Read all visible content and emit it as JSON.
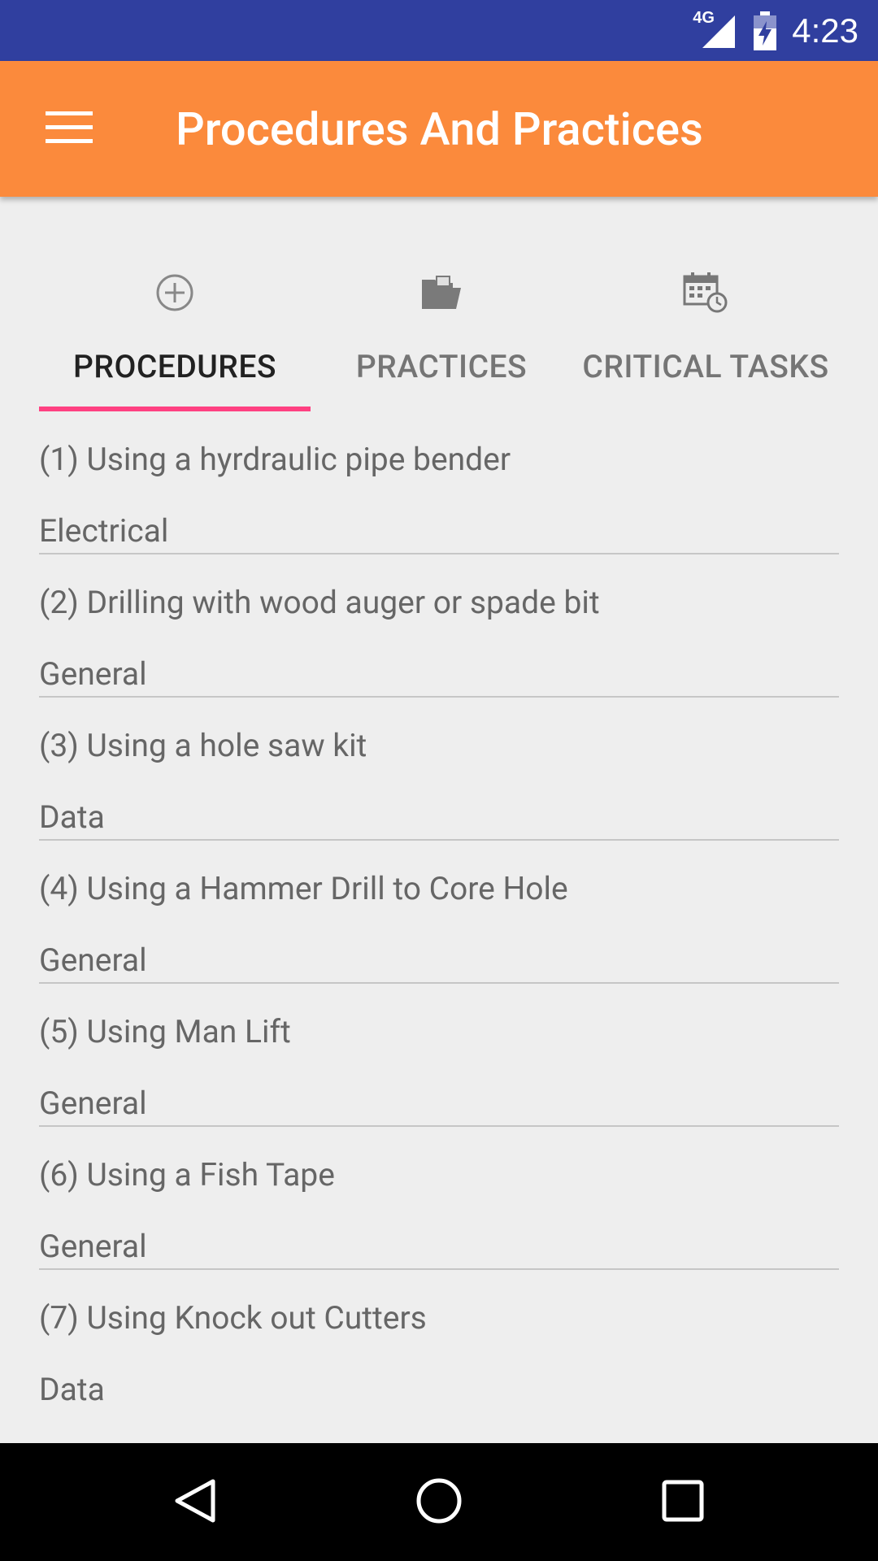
{
  "status_bar": {
    "network": "4G",
    "time": "4:23"
  },
  "app_bar": {
    "title": "Procedures And Practices",
    "menu_icon": "hamburger-menu-icon"
  },
  "tabs": [
    {
      "label": "PROCEDURES",
      "icon": "add-circle-icon",
      "active": true
    },
    {
      "label": "PRACTICES",
      "icon": "open-folder-icon",
      "active": false
    },
    {
      "label": "CRITICAL TASKS",
      "icon": "calendar-refresh-icon",
      "active": false
    }
  ],
  "accent_color": "#ff4081",
  "app_bar_color": "#fb8a3c",
  "status_bar_color": "#303f9f",
  "procedures": [
    {
      "title": "(1) Using a hyrdraulic pipe bender",
      "category": "Electrical"
    },
    {
      "title": "(2) Drilling with wood auger or spade bit",
      "category": "General"
    },
    {
      "title": "(3) Using a hole saw kit",
      "category": "Data"
    },
    {
      "title": "(4) Using a Hammer Drill to Core Hole",
      "category": "General"
    },
    {
      "title": "(5) Using Man Lift",
      "category": "General"
    },
    {
      "title": "(6) Using a Fish Tape",
      "category": "General"
    },
    {
      "title": "(7) Using Knock out Cutters",
      "category": "Data"
    }
  ],
  "nav_bar": {
    "back": "back-icon",
    "home": "home-icon",
    "recents": "recents-icon"
  }
}
